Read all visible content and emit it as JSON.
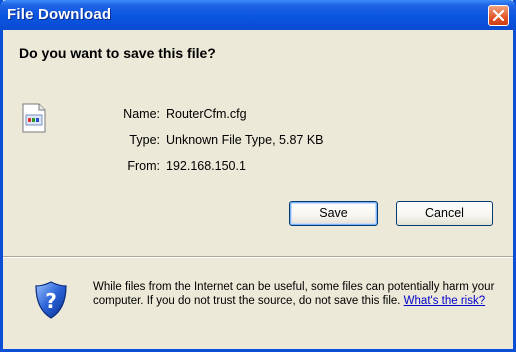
{
  "window": {
    "title": "File Download"
  },
  "dialog": {
    "question": "Do you want to save this file?",
    "file": {
      "name_label": "Name:",
      "name_value": "RouterCfm.cfg",
      "type_label": "Type:",
      "type_value": "Unknown File Type, 5.87 KB",
      "from_label": "From:",
      "from_value": "192.168.150.1"
    },
    "buttons": {
      "save": "Save",
      "cancel": "Cancel"
    },
    "warning": {
      "text": "While files from the Internet can be useful, some files can potentially harm your computer. If you do not trust the source, do not save this file. ",
      "link": "What's the risk?"
    }
  },
  "colors": {
    "titlebar": "#0b55e0",
    "dialog_bg": "#ece9d8",
    "close_button": "#e2572a",
    "link": "#0000cc"
  },
  "icons": [
    "close-icon",
    "file-icon",
    "shield-icon"
  ]
}
